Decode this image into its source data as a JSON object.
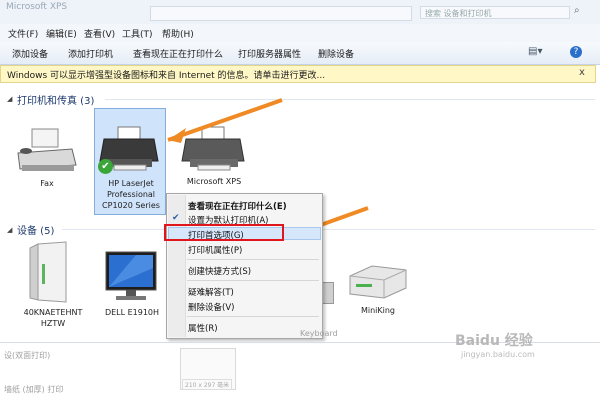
{
  "window": {
    "title": "Microsoft XPS",
    "search_placeholder": "搜索 设备和打印机"
  },
  "menubar": {
    "items": [
      "文件(F)",
      "编辑(E)",
      "查看(V)",
      "工具(T)",
      "帮助(H)"
    ]
  },
  "toolbar": {
    "buttons": [
      "添加设备",
      "添加打印机",
      "查看现在正在打印什么",
      "打印服务器属性",
      "删除设备"
    ]
  },
  "infobar": {
    "text": "Windows 可以显示增强型设备图标和来自 Internet 的信息。请单击进行更改...",
    "close": "x"
  },
  "printers": {
    "heading": "打印机和传真 (3)",
    "items": [
      {
        "label": "Fax"
      },
      {
        "label_lines": [
          "HP LaserJet",
          "Professional",
          "CP1020 Series"
        ],
        "default": true
      },
      {
        "label_lines": [
          "Microsoft XPS"
        ]
      }
    ]
  },
  "devices": {
    "heading": "设备 (5)",
    "items": [
      {
        "label_lines": [
          "40KNAETEHNT",
          "HZTW"
        ]
      },
      {
        "label_lines": [
          "DELL E1910H"
        ]
      },
      {
        "label_lines": [
          "MiniKing"
        ]
      }
    ]
  },
  "context_menu": {
    "items": [
      {
        "label": "查看现在正在打印什么(E)",
        "bold": true
      },
      {
        "label": "设置为默认打印机(A)",
        "checked": true
      },
      {
        "label": "打印首选项(G)",
        "highlighted": true
      },
      {
        "label": "打印机属性(P)"
      },
      {
        "label": "创建快捷方式(S)"
      },
      {
        "label": "疑难解答(T)"
      },
      {
        "label": "删除设备(V)"
      },
      {
        "label": "属性(R)"
      }
    ]
  },
  "background_fragments": {
    "left_line1": "设(双面打印)",
    "left_line2": "墙纸 (加厚) 打印",
    "keyboard": "Keyboard",
    "size_caption": "210 x 297 毫米"
  },
  "watermark": {
    "brand": "Baidu 经验",
    "url": "jingyan.baidu.com"
  },
  "colors": {
    "accent_red": "#e0161c",
    "arrow_orange": "#f08a24",
    "selection": "#cfe3fb",
    "infobar": "#fff8c6"
  }
}
